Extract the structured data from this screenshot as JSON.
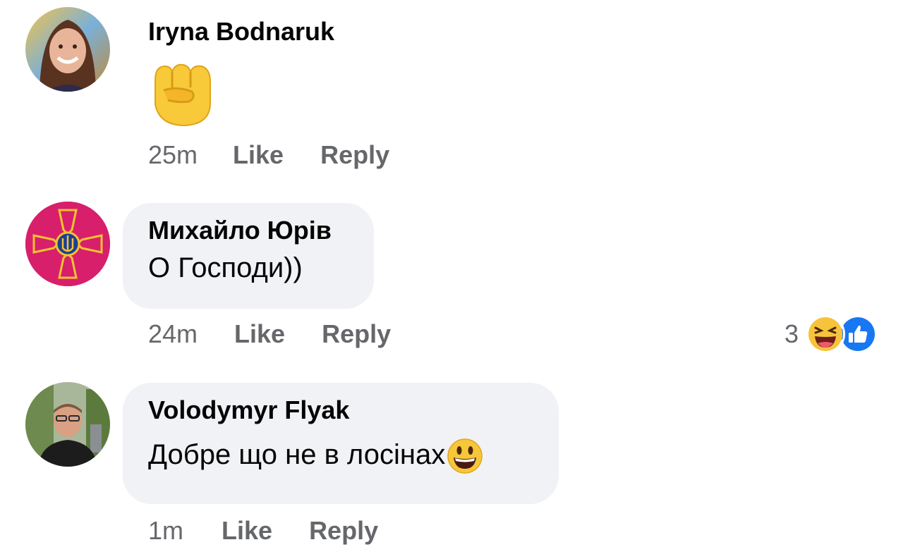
{
  "comments": [
    {
      "author": "Iryna Bodnaruk",
      "body_emoji": "raised-fist-emoji",
      "time": "25m",
      "like": "Like",
      "reply": "Reply"
    },
    {
      "author": "Михайло Юрів",
      "text": "О Господи))",
      "time": "24m",
      "like": "Like",
      "reply": "Reply",
      "reaction_count": "3",
      "reaction_icons": [
        "laughing-emoji",
        "like-icon"
      ]
    },
    {
      "author": "Volodymyr Flyak",
      "text": "Добре що не в лосінах",
      "trailing_emoji": "smiling-emoji",
      "time": "1m",
      "like": "Like",
      "reply": "Reply"
    }
  ],
  "colors": {
    "bubble": "#f0f2f5",
    "meta_text": "#65676b",
    "like_blue": "#1877f2",
    "emblem_red": "#d81f6b",
    "emblem_gold": "#f2c230"
  }
}
